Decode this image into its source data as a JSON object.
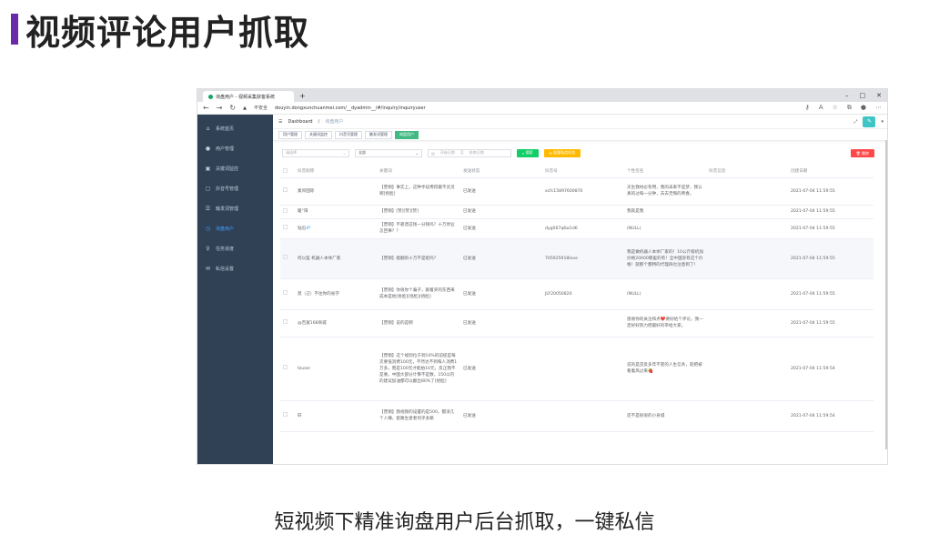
{
  "slide": {
    "title": "视频评论用户抓取",
    "caption": "短视频下精准询盘用户后台抓取，一键私信"
  },
  "browser": {
    "tab_title": "询盘用户 - 视频采集获客系统",
    "url": "douyin.dongxunchuanmei.com/__dyadmin__/#/inquiry/inquiryuser",
    "security_label": "不安全"
  },
  "sidebar": {
    "items": [
      {
        "label": "系统首页",
        "icon": "home-icon"
      },
      {
        "label": "用户管理",
        "icon": "user-icon"
      },
      {
        "label": "关键词监控",
        "icon": "monitor-icon"
      },
      {
        "label": "抖音号管理",
        "icon": "account-icon"
      },
      {
        "label": "触发词管理",
        "icon": "list-icon"
      },
      {
        "label": "询盘用户",
        "icon": "clock-icon"
      },
      {
        "label": "任务进度",
        "icon": "trophy-icon"
      },
      {
        "label": "私信设置",
        "icon": "mail-icon"
      }
    ]
  },
  "navbar": {
    "crumb_home": "Dashboard",
    "crumb_current": "询盘用户"
  },
  "tags": [
    "用户管理",
    "关键词监控",
    "抖音号管理",
    "触发词管理",
    "询盘用户"
  ],
  "filters": {
    "status_placeholder": "请选择",
    "type_value": "全部",
    "date_start": "开始日期",
    "date_sep": "至",
    "date_end": "结束日期",
    "search_label": "搜索",
    "batch_label": "批量私信任务",
    "delete_label": "删除"
  },
  "table": {
    "headers": [
      "抖音昵称",
      "关键词",
      "发送状态",
      "抖音号",
      "个性签名",
      "抖音信息",
      "创建日期"
    ],
    "rows": [
      {
        "nick": "素卯国际",
        "keyword": "【营销】事实上，这种手段用得最不灵灵啊[捂脸]",
        "status": "已发送",
        "account": "xcfc15897600870",
        "sign": "天生我材必有用，我的未来不是梦，我认真的过每一分钟，去去无悔的青春。",
        "info": "",
        "date": "2021-07-04 11:59:55"
      },
      {
        "nick": "暖°阳",
        "keyword": "【营销】[赞][赞][赞]",
        "status": "已发送",
        "account": "",
        "sign": "我就是我",
        "info": "",
        "date": "2021-07-04 11:59:55"
      },
      {
        "nick": "钻石💎",
        "keyword": "【营销】不靠谱这钱一分钱吗？十万停业怎回事？？",
        "status": "已发送",
        "account": "dyg067q6w1d6",
        "sign": "(NULL)",
        "info": "",
        "date": "2021-07-04 11:59:55"
      },
      {
        "nick": "何以笙 机器人本体厂家",
        "keyword": "【营销】能翻的十万不是挺吗？",
        "status": "已发送",
        "account": "705925918love",
        "sign": "我是做机器人本体厂家的！10公斤级机加价格20000哪里的有！全中国没有这个价格！就那个都特的代理商也注意到了！",
        "info": "",
        "date": "2021-07-04 11:59:55"
      },
      {
        "nick": "莫（己）不往你的省学",
        "keyword": "【营销】你很你个骗子，跟着买的东西来成本是他[捂脸][捂脸][捂脸]",
        "status": "已发送",
        "account": "JLY20050820",
        "sign": "(NULL)",
        "info": "",
        "date": "2021-07-04 11:59:55"
      },
      {
        "nick": "@百富168商城",
        "keyword": "【营销】说的是啊",
        "status": "已发送",
        "account": "",
        "sign": "感谢你的关注和点❤️要好给个评论，我一定好好努力把最好的带给大家。",
        "info": "",
        "date": "2021-07-04 11:59:55"
      },
      {
        "nick": "tzuser",
        "keyword": "【营销】这个规则位于到10%的前提是每次要低消费100元，不然达不到每人消费1万多，而是100元才能拍10元，反正我不是要。中国大部分计算不是数，150以内的建议加油都可以翻出80%了[捂脸]",
        "status": "已发送",
        "account": "",
        "sign": "说的是违反多年不变的人生信条，就把被看着风过来🍓",
        "info": "",
        "date": "2021-07-04 11:59:54"
      },
      {
        "nick": "轩",
        "keyword": "【营销】我视频的设置的是500，都没几个人赚，套路生意者何乎多路",
        "status": "已发送",
        "account": "",
        "sign": "还不是很很的小县城",
        "info": "",
        "date": "2021-07-04 11:59:54"
      }
    ]
  }
}
